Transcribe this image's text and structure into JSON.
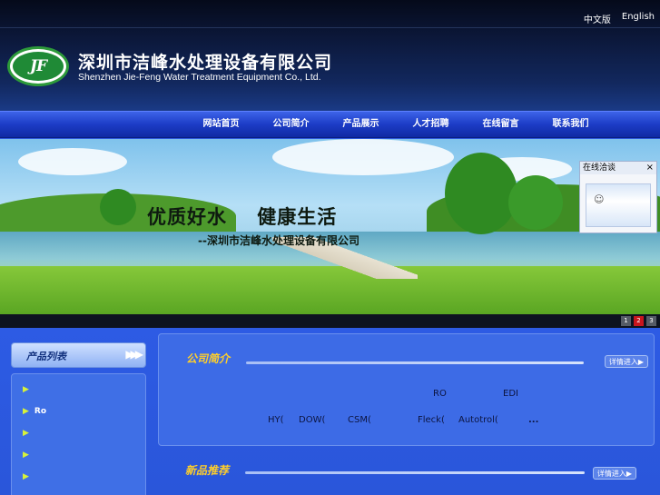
{
  "header": {
    "lang_cn": "中文版",
    "lang_en": "English",
    "logo_text": "JF",
    "company_cn": "深圳市洁峰水处理设备有限公司",
    "company_en": "Shenzhen Jie-Feng Water Treatment Equipment  Co., Ltd."
  },
  "nav": {
    "items": [
      "网站首页",
      "公司简介",
      "产品展示",
      "人才招聘",
      "在线留言",
      "联系我们"
    ]
  },
  "banner": {
    "slogan": "优质好水    健康生活",
    "sub": "--深圳市洁峰水处理设备有限公司",
    "chat_title": "在线洽谈",
    "chat_close": "×",
    "pager": [
      "1",
      "2",
      "3"
    ],
    "active_page": "2"
  },
  "sidebar": {
    "title": "产品列表",
    "arrows": "▶▶▶",
    "items": [
      "",
      "Ro",
      "",
      "",
      ""
    ]
  },
  "about": {
    "title": "公司简介",
    "more": "详情进入▶",
    "line1": [
      "RO",
      "EDI"
    ],
    "line2": [
      "HY(",
      "DOW(",
      "CSM(",
      "Fleck(",
      "Autotrol(",
      "..."
    ]
  },
  "new_products": {
    "title": "新品推荐",
    "more": "详情进入▶"
  },
  "colors": {
    "nav_bg": "#1c3cc6",
    "accent_yellow": "#ffcf2a",
    "pager_active": "#c8161e",
    "logo_green": "#1f8a36"
  }
}
